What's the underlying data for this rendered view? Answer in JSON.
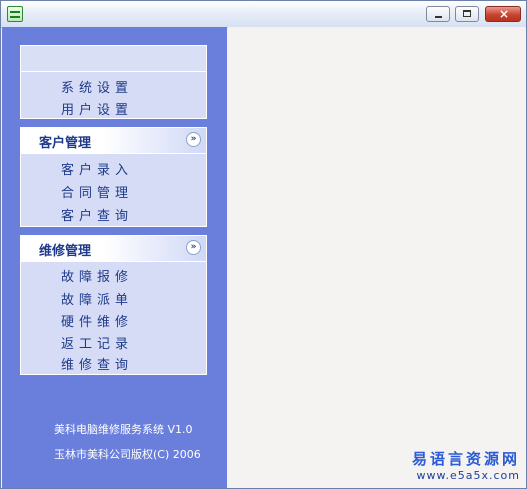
{
  "window": {
    "icon": "app-icon",
    "buttons": {
      "min": "minimize-icon",
      "max": "maximize-icon",
      "close": "×"
    }
  },
  "sidebar": {
    "group1": {
      "items": [
        "系统设置",
        "用户设置"
      ]
    },
    "group2": {
      "title": "客户管理",
      "toggle": "»",
      "items": [
        "客户录入",
        "合同管理",
        "客户查询"
      ]
    },
    "group3": {
      "title": "维修管理",
      "toggle": "»",
      "items": [
        "故障报修",
        "故障派单",
        "硬件维修",
        "返工记录",
        "维修查询"
      ]
    },
    "footer": {
      "line1": "美科电脑维修服务系统 V1.0",
      "line2": "玉林市美科公司版权(C) 2006"
    }
  },
  "watermark": {
    "line1": "易语言资源网",
    "line2": "www.e5a5x.com"
  },
  "colors": {
    "sidebar": "#6a7fdb",
    "group_bg": "#d6dcf6",
    "text": "#1f3a8a"
  }
}
